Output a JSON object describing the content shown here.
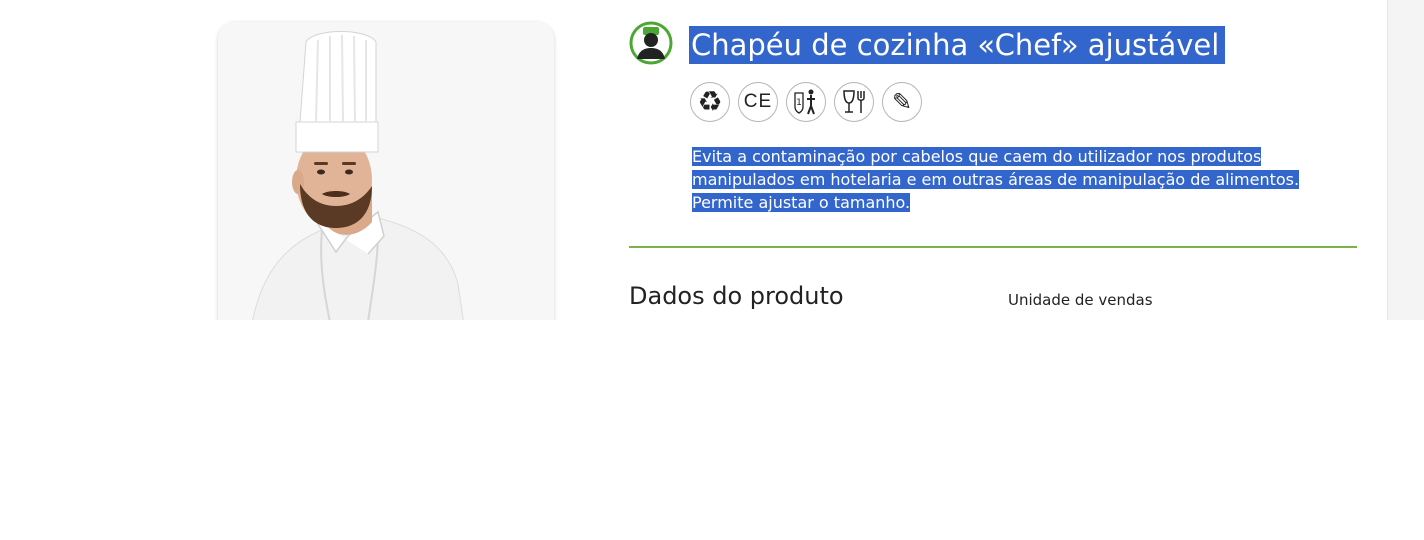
{
  "product": {
    "title": "Chapéu de cozinha «Chef» ajustável",
    "description": "Evita a contaminação por cabelos que caem do utilizador nos produtos manipulados em hotelaria e em outras áreas de manipulação de alimentos. Permite ajustar o tamanho.",
    "category_icon": "chef-head-icon",
    "image_alt": "chef-with-tall-hat-photo"
  },
  "badges": [
    {
      "name": "recycle-icon",
      "glyph": "♻"
    },
    {
      "name": "ce-mark-icon",
      "glyph": "CE"
    },
    {
      "name": "user-category-1-icon",
      "glyph": "1"
    },
    {
      "name": "food-contact-icon",
      "glyph": ""
    },
    {
      "name": "customizable-pencil-icon",
      "glyph": "✎"
    }
  ],
  "details": {
    "section_title": "Dados do produto",
    "sales_unit_label": "Unidade de vendas"
  },
  "colors": {
    "accent_green": "#7db249",
    "selection_blue": "#3366cc",
    "icon_green": "#4aa832"
  }
}
